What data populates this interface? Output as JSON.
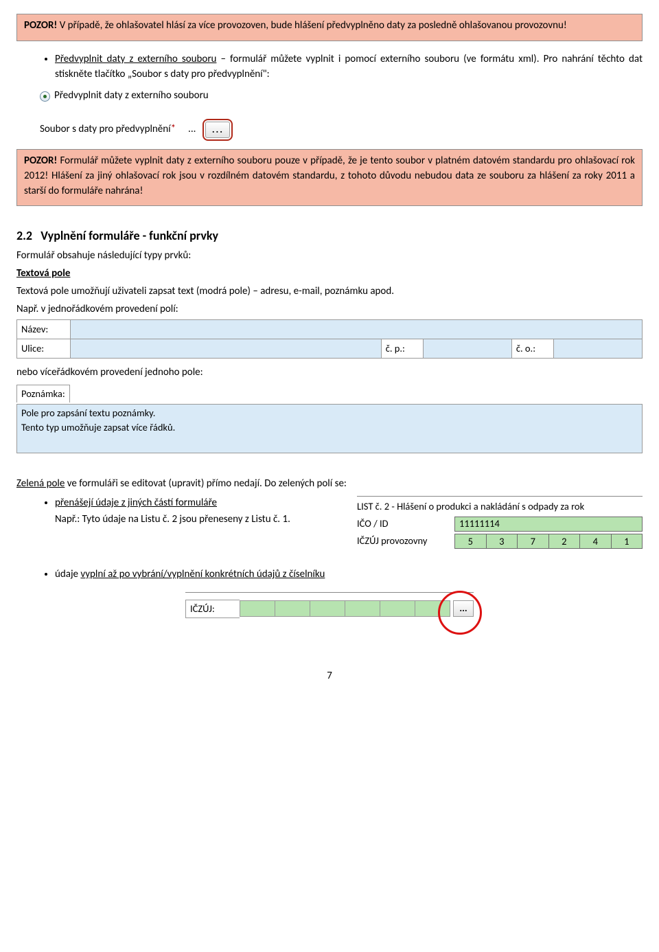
{
  "warn1": {
    "strong": "POZOR!",
    "text": " V případě, že ohlašovatel hlásí za více provozoven, bude hlášení předvyplněno daty za posledně ohlašovanou provozovnu!"
  },
  "bullet1": {
    "lead": "Předvyplnit daty z externího souboru",
    "rest": " – formulář můžete vyplnit i pomocí externího souboru (ve formátu xml). Pro nahrání těchto dat stiskněte tlačítko „Soubor s daty pro předvyplnění\":"
  },
  "radio_label": "Předvyplnit daty z externího souboru",
  "file_label": "Soubor s daty pro předvyplnění",
  "dots": "...",
  "warn2": {
    "strong": "POZOR!",
    "text": " Formulář můžete vyplnit daty z externího souboru pouze v případě, že je tento soubor v platném datovém standardu pro ohlašovací rok 2012! Hlášení za jiný ohlašovací rok jsou v rozdílném datovém standardu, z tohoto důvodu nebudou data ze souboru za hlášení za roky 2011 a starší do formuláře nahrána!"
  },
  "section": {
    "num": "2.2",
    "title": "Vyplnění formuláře - funkční prvky"
  },
  "intro": "Formulář obsahuje následující typy prvků:",
  "textova_pole": "Textová pole",
  "textova_desc": "Textová pole umožňují uživateli zapsat text (modrá pole) – adresu, e-mail, poznámku apod.",
  "napr1": "Např. v jednořádkovém provedení polí:",
  "labels": {
    "nazev": "Název:",
    "ulice": "Ulice:",
    "cp": "č. p.:",
    "co": "č. o.:"
  },
  "nebo": "nebo víceřádkovém provedení jednoho pole:",
  "poznamka_label": "Poznámka:",
  "poznamka_text1": "Pole pro zapsání textu poznámky.",
  "poznamka_text2": "Tento typ umožňuje zapsat více řádků.",
  "zelena_intro1": "Zelená pole",
  "zelena_intro2": " ve formuláři se editovat (upravit) přímo nedají. Do zelených polí se:",
  "green_bullet1": "přenášejí údaje z jiných částí formuláře",
  "green_napr1": "Např.: Tyto údaje na Listu č. 2 jsou přeneseny z Listu č. 1.",
  "green_panel": {
    "title": "LIST č. 2 - Hlášení o produkci a nakládání s odpady za rok",
    "ico_label": "IČO / ID",
    "ico_val": "11111114",
    "iczuj_label": "IČZÚJ provozovny",
    "iczuj_vals": [
      "5",
      "3",
      "7",
      "2",
      "4",
      "1"
    ]
  },
  "green_bullet2a": "údaje ",
  "green_bullet2b": "vyplní až po vybrání/vyplnění konkrétních údajů z číselníku",
  "iczuj2_label": "IČZÚJ:",
  "page": "7"
}
